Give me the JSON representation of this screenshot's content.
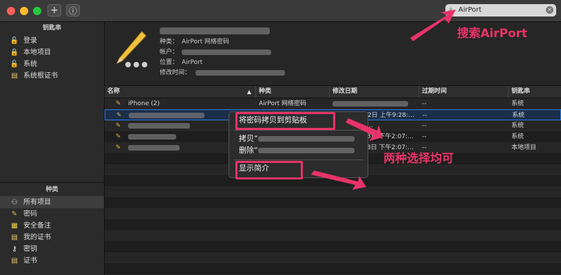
{
  "toolbar": {
    "add_label": "+",
    "info_label": "ⓘ",
    "search_value": "AirPort"
  },
  "sidebar": {
    "keychains_header": "钥匙串",
    "keychains": [
      {
        "label": "登录",
        "icon": "lock-open-icon"
      },
      {
        "label": "本地项目",
        "icon": "lock-icon"
      },
      {
        "label": "系统",
        "icon": "lock-icon"
      },
      {
        "label": "系统根证书",
        "icon": "certificate-icon"
      }
    ],
    "categories_header": "种类",
    "categories": [
      {
        "label": "所有项目",
        "icon": "people-icon"
      },
      {
        "label": "密码",
        "icon": "pencil-icon"
      },
      {
        "label": "安全备注",
        "icon": "note-icon"
      },
      {
        "label": "我的证书",
        "icon": "certificate-icon"
      },
      {
        "label": "密钥",
        "icon": "key-icon"
      },
      {
        "label": "证书",
        "icon": "certificate-icon"
      }
    ]
  },
  "info": {
    "kind_label": "种类：",
    "kind_value": "AirPort 网络密码",
    "account_label": "帐户：",
    "where_label": "位置：",
    "where_value": "AirPort",
    "modified_label": "修改时间："
  },
  "table": {
    "columns": [
      "名称",
      "种类",
      "修改日期",
      "过期时间",
      "钥匙串"
    ],
    "rows": [
      {
        "name": "iPhone (2)",
        "kind": "AirPort 网络密码",
        "date": "",
        "expires": "--",
        "keychain": "系统"
      },
      {
        "name": "",
        "kind": "",
        "date": "2日 上午9:28:…",
        "expires": "--",
        "keychain": "系统"
      },
      {
        "name": "",
        "kind": "",
        "date": "…",
        "expires": "--",
        "keychain": "系统"
      },
      {
        "name": "",
        "kind": "",
        "date": "3日 下午2:07:…",
        "expires": "--",
        "keychain": "系统"
      },
      {
        "name": "",
        "kind": "",
        "date": "3日 下午2:07:…",
        "expires": "--",
        "keychain": "本地项目"
      }
    ]
  },
  "menu": {
    "copy_password": "将密码拷贝到剪贴板",
    "copy": "拷贝“",
    "delete": "删除“",
    "get_info": "显示简介"
  },
  "annotations": {
    "search": "搜索AirPort",
    "either": "两种选择均可"
  },
  "colors": {
    "accent": "#e8336a",
    "selection": "#1f64c8"
  }
}
